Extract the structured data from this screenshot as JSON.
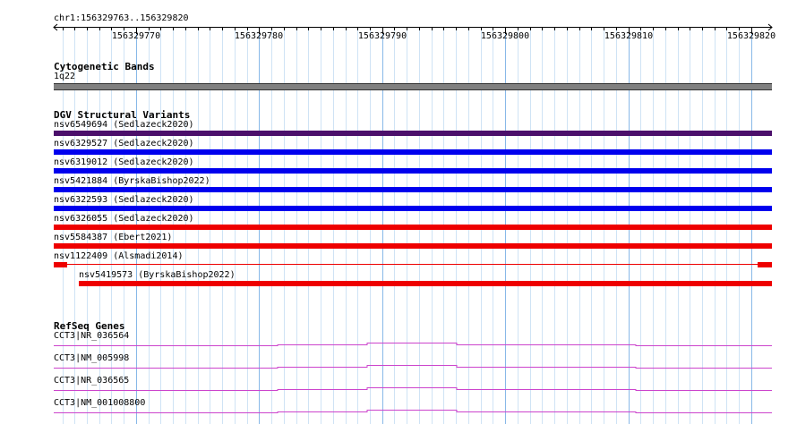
{
  "region": {
    "label": "chr1:156329763..156329820",
    "start": 156329763,
    "end": 156329820
  },
  "ruler": {
    "ticks": [
      "156329770",
      "156329780",
      "156329790",
      "156329800",
      "156329810",
      "156329820"
    ]
  },
  "cytoband": {
    "title": "Cytogenetic Bands",
    "band_label": "1q22",
    "band_color": "#808080"
  },
  "dgv": {
    "title": "DGV Structural Variants",
    "variants": [
      {
        "label": "nsv6549694 (Sedlazeck2020)",
        "color": "#4b0f6b",
        "start": 156329763,
        "end": 156329820
      },
      {
        "label": "nsv6329527 (Sedlazeck2020)",
        "color": "#0000ee",
        "start": 156329763,
        "end": 156329820
      },
      {
        "label": "nsv6319012 (Sedlazeck2020)",
        "color": "#0000ee",
        "start": 156329763,
        "end": 156329820
      },
      {
        "label": "nsv5421884 (ByrskaBishop2022)",
        "color": "#0000ee",
        "start": 156329763,
        "end": 156329820
      },
      {
        "label": "nsv6322593 (Sedlazeck2020)",
        "color": "#0000ee",
        "start": 156329763,
        "end": 156329820
      },
      {
        "label": "nsv6326055 (Sedlazeck2020)",
        "color": "#ee0000",
        "start": 156329763,
        "end": 156329820
      },
      {
        "label": "nsv5584387 (Ebert2021)",
        "color": "#ee0000",
        "start": 156329763,
        "end": 156329820
      },
      {
        "label": "nsv1122409 (Alsmadi2014)",
        "color": "#ee0000",
        "start": 156329763,
        "end": 156329820,
        "gapped": true
      },
      {
        "label": "nsv5419573 (ByrskaBishop2022)",
        "color": "#ee0000",
        "start": 156329765,
        "end": 156329820
      }
    ]
  },
  "refseq": {
    "title": "RefSeq Genes",
    "line_color": "#cc44cc",
    "genes": [
      {
        "label": "CCT3|NR_036564"
      },
      {
        "label": "CCT3|NM_005998"
      },
      {
        "label": "CCT3|NR_036565"
      },
      {
        "label": "CCT3|NM_001008800"
      }
    ]
  }
}
